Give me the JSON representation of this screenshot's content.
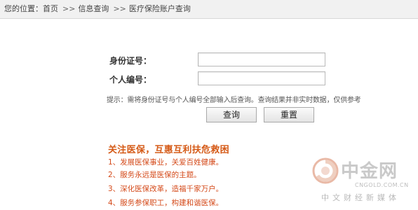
{
  "breadcrumb": {
    "lead": "您的位置：",
    "items": [
      "首页",
      "信息查询",
      "医疗保险账户查询"
    ],
    "separator": ">>"
  },
  "form": {
    "id_label": "身份证号：",
    "id_value": "",
    "personal_no_label": "个人编号：",
    "personal_no_value": "",
    "hint": "提示：需将身份证号与个人编号全部输入后查询。查询结果并非实时数据，仅供参考",
    "query_button": "查询",
    "reset_button": "重置"
  },
  "promo": {
    "title": "关注医保，互惠互利扶危救困",
    "items": [
      "1、发展医保事业，关爱百姓健康。",
      "2、服务永远是医保的主题。",
      "3、深化医保改革，造福千家万户。",
      "4、服务参保职工，构建和谐医保。"
    ]
  },
  "watermark": {
    "name": "中金网",
    "domain": "CNGOLD.COM.CN",
    "slogan": "中文财经新媒体"
  },
  "colors": {
    "promo": "#d44a1a",
    "breadcrumb_bg": "#f1f1f1"
  }
}
